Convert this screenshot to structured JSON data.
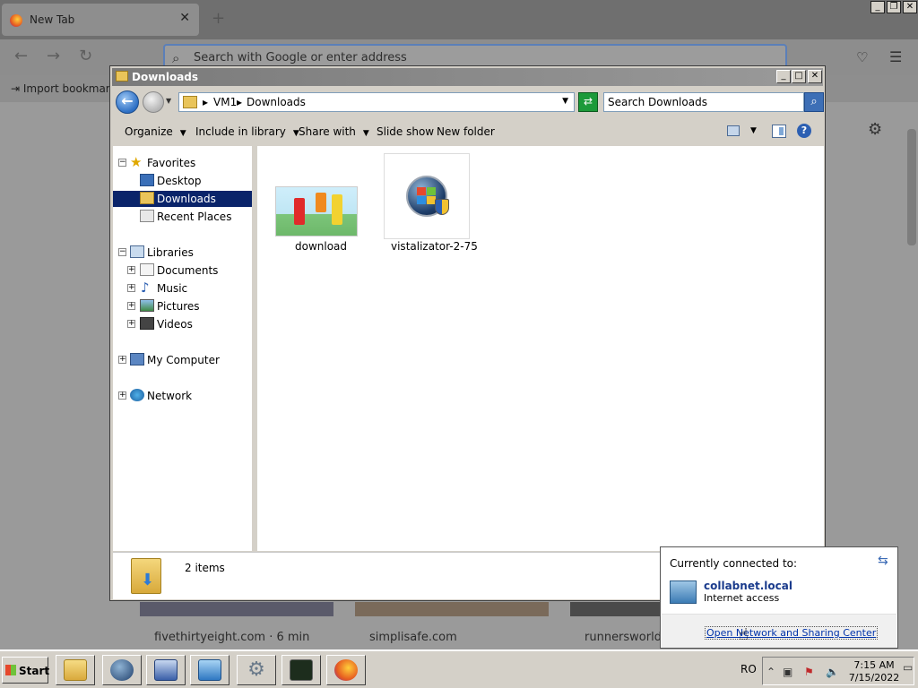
{
  "browser": {
    "tab_title": "New Tab",
    "tab_close": "✕",
    "new_tab": "+",
    "url_placeholder": "Search with Google or enter address",
    "import_bookmarks": "Import bookmarks...",
    "window_controls": [
      "_",
      "❐",
      "✕"
    ],
    "top_sites": [
      {
        "label": "fivethirtyeight.com · 6 min"
      },
      {
        "label": "simplisafe.com"
      },
      {
        "label": "runnersworld.co"
      }
    ]
  },
  "explorer": {
    "title": "Downloads",
    "window_controls": [
      "_",
      "□",
      "✕"
    ],
    "breadcrumb": [
      "VM1",
      "Downloads"
    ],
    "search_placeholder": "Search Downloads",
    "commands": [
      {
        "label": "Organize",
        "has_dropdown": true
      },
      {
        "label": "Include in library",
        "has_dropdown": true
      },
      {
        "label": "Share with",
        "has_dropdown": true
      },
      {
        "label": "Slide show",
        "has_dropdown": false
      },
      {
        "label": "New folder",
        "has_dropdown": false
      }
    ],
    "nav": {
      "favorites": {
        "label": "Favorites",
        "items": [
          "Desktop",
          "Downloads",
          "Recent Places"
        ],
        "selected": "Downloads"
      },
      "libraries": {
        "label": "Libraries",
        "items": [
          "Documents",
          "Music",
          "Pictures",
          "Videos"
        ]
      },
      "computer": "My Computer",
      "network": "Network"
    },
    "files": [
      {
        "name": "download",
        "kind": "image-thumbnail"
      },
      {
        "name": "vistalizator-2-75",
        "kind": "application-icon"
      }
    ],
    "status": "2 items"
  },
  "network_popup": {
    "header": "Currently connected to:",
    "network_name": "collabnet.local",
    "network_status": "Internet access",
    "link": "Open Network and Sharing Center"
  },
  "taskbar": {
    "start_label": "Start",
    "language": "RO",
    "time": "7:15 AM",
    "date": "7/15/2022"
  },
  "colors": {
    "selection": "#0a246a",
    "link": "#0033aa",
    "network_name": "#1a3b8c"
  }
}
